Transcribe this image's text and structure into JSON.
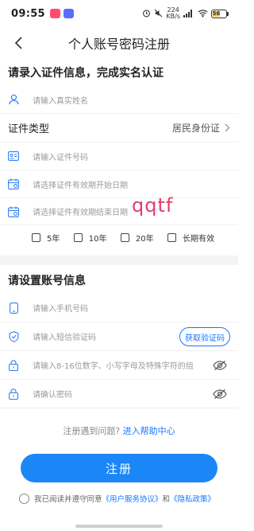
{
  "status_bar": {
    "time": "09:55",
    "network_speed": "224\nKB/s",
    "battery_level": "56"
  },
  "nav": {
    "title": "个人账号密码注册"
  },
  "identity_section": {
    "title": "请录入证件信息，完成实名认证",
    "name_placeholder": "请输入真实姓名",
    "id_type_label": "证件类型",
    "id_type_value": "居民身份证",
    "id_number_placeholder": "请输入证件号码",
    "valid_start_placeholder": "请选择证件有效期开始日期",
    "valid_end_placeholder": "请选择证件有效期结束日期",
    "validity_options": [
      "5年",
      "10年",
      "20年",
      "长期有效"
    ]
  },
  "account_section": {
    "title": "请设置账号信息",
    "phone_placeholder": "请输入手机号码",
    "sms_placeholder": "请输入短信验证码",
    "get_code_label": "获取验证码",
    "password_placeholder": "请输入8-16位数字、小写字母及特殊字符的组",
    "confirm_placeholder": "请确认密码"
  },
  "help": {
    "question": "注册遇到问题?",
    "link": "进入帮助中心"
  },
  "register_button": "注册",
  "agreement": {
    "prefix": "我已阅读并遵守同意",
    "user_agreement": "《用户服务协议》",
    "and": "和",
    "privacy": "《隐私政策》"
  },
  "watermark": "qqtf",
  "colors": {
    "accent": "#1677ff",
    "button": "#1b86f6",
    "watermark": "#e23d6a"
  }
}
